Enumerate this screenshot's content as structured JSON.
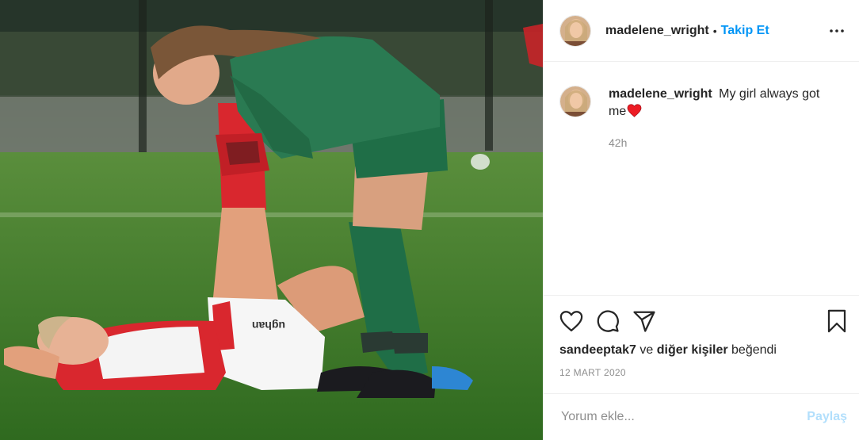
{
  "post": {
    "username": "madelene_wright",
    "follow_label": "Takip Et",
    "separator": "•",
    "caption": "My girl always got me",
    "caption_emoji": "red-heart",
    "time_ago": "42h",
    "likes": {
      "user": "sandeeptak7",
      "connector": "ve",
      "others": "diğer kişiler",
      "suffix": "beğendi"
    },
    "date": "12 MART 2020"
  },
  "comment": {
    "placeholder": "Yorum ekle...",
    "share_label": "Paylaş"
  },
  "photo": {
    "shorts_text": "ughan"
  },
  "icons": {
    "more": "more-options-icon",
    "like": "heart-icon",
    "comment": "comment-icon",
    "share": "paper-plane-icon",
    "save": "bookmark-icon"
  },
  "colors": {
    "accent": "#0095f6",
    "share_disabled": "#b2dffc",
    "muted": "#8e8e8e",
    "heart": "#ed1c24"
  }
}
